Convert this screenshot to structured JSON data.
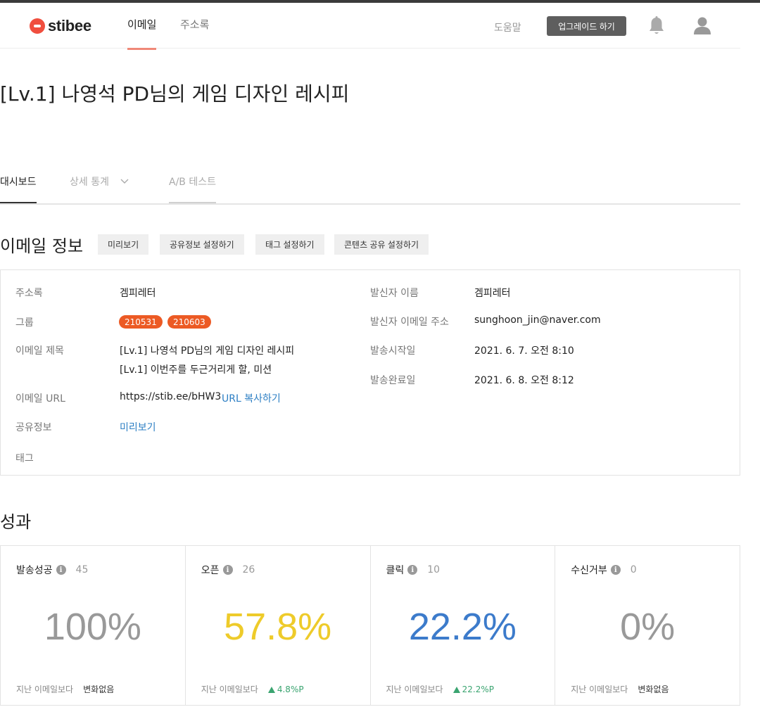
{
  "nav": {
    "logo_text": "stibee",
    "tabs": [
      {
        "label": "이메일",
        "active": true
      },
      {
        "label": "주소록",
        "active": false
      }
    ],
    "help_label": "도움말",
    "upgrade_label": "업그레이드 하기",
    "icons": [
      "bell-icon",
      "user-icon"
    ]
  },
  "page": {
    "title": "[Lv.1] 나영석 PD님의 게임 디자인 레시피"
  },
  "tabs": [
    {
      "label": "대시보드",
      "active": true
    },
    {
      "label": "상세 통계",
      "has_dropdown": true
    },
    {
      "label": "A/B 테스트"
    }
  ],
  "email_info": {
    "section_title": "이메일 정보",
    "buttons": [
      "미리보기",
      "공유정보 설정하기",
      "태그 설정하기",
      "콘텐츠 공유 설정하기"
    ],
    "left": {
      "address_book_label": "주소록",
      "address_book_value": "겜피레터",
      "group_label": "그룹",
      "groups": [
        "210531",
        "210603"
      ],
      "subject_label": "이메일 제목",
      "subject_lines": [
        "[Lv.1] 나영석 PD님의 게임 디자인 레시피",
        "[Lv.1] 이번주를 두근거리게 할, 미션"
      ],
      "url_label": "이메일 URL",
      "url_value": "https://stib.ee/bHW3",
      "url_copy_label": "URL 복사하기",
      "share_label": "공유정보",
      "share_value": "미리보기",
      "tag_label": "태그"
    },
    "right": {
      "sender_name_label": "발신자 이름",
      "sender_name_value": "겜피레터",
      "sender_email_label": "발신자 이메일 주소",
      "sender_email_value": "sunghoon_jin@naver.com",
      "send_start_label": "발송시작일",
      "send_start_value": "2021. 6. 7. 오전 8:10",
      "send_end_label": "발송완료일",
      "send_end_value": "2021. 6. 8. 오전 8:12"
    }
  },
  "performance": {
    "section_title": "성과",
    "info_glyph": "i",
    "compare_label": "지난 이메일보다",
    "cards": [
      {
        "label": "발송성공",
        "count": "45",
        "value": "100%",
        "color": "#999999",
        "delta": "변화없음",
        "delta_up": false
      },
      {
        "label": "오픈",
        "count": "26",
        "value": "57.8%",
        "color": "#eecb2a",
        "delta": "4.8%P",
        "delta_up": true
      },
      {
        "label": "클릭",
        "count": "10",
        "value": "22.2%",
        "color": "#3c7bcb",
        "delta": "22.2%P",
        "delta_up": true
      },
      {
        "label": "수신거부",
        "count": "0",
        "value": "0%",
        "color": "#999999",
        "delta": "변화없음",
        "delta_up": false
      }
    ]
  }
}
